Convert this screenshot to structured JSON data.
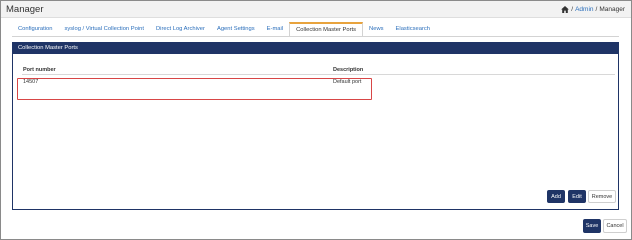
{
  "header": {
    "title": "Manager",
    "breadcrumb": [
      "Admin",
      "Manager"
    ],
    "breadcrumb_sep": "/"
  },
  "tabs": [
    {
      "label": "Configuration",
      "active": false
    },
    {
      "label": "syslog / Virtual Collection Point",
      "active": false
    },
    {
      "label": "Direct Log Archiver",
      "active": false
    },
    {
      "label": "Agent Settings",
      "active": false
    },
    {
      "label": "E-mail",
      "active": false
    },
    {
      "label": "Collection Master Ports",
      "active": true
    },
    {
      "label": "News",
      "active": false
    },
    {
      "label": "Elasticsearch",
      "active": false
    }
  ],
  "panel": {
    "title": "Collection Master Ports",
    "columns": [
      "Port number",
      "Description"
    ],
    "rows": [
      {
        "port": "14507",
        "description": "Default port"
      }
    ],
    "buttons": {
      "add": "Add",
      "edit": "Edit",
      "remove": "Remove"
    }
  },
  "footer": {
    "save": "Save",
    "cancel": "Cancel"
  },
  "colors": {
    "accent": "#1f3466",
    "link": "#2a6ebb",
    "active_tab_top": "#e8a33d",
    "highlight": "#d84646"
  }
}
